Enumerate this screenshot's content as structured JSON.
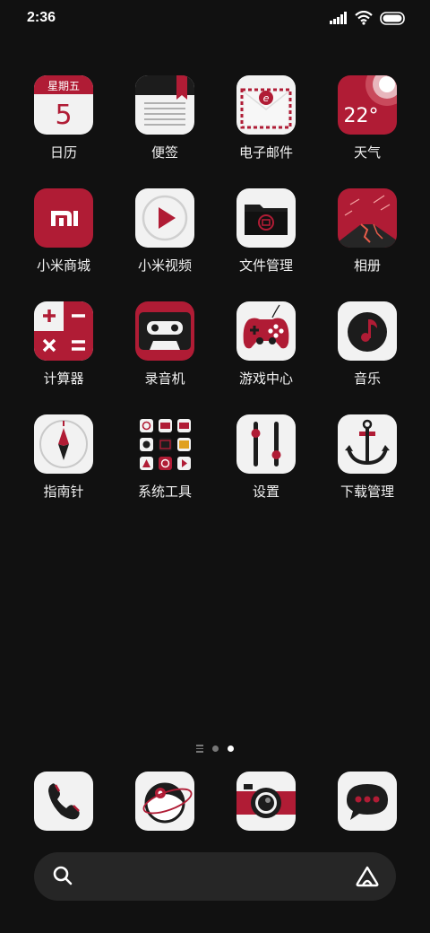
{
  "status": {
    "time": "2:36",
    "icons": [
      "signal-icon",
      "wifi-icon",
      "battery-icon"
    ]
  },
  "colors": {
    "background": "#111111",
    "accent": "#b01c35",
    "tile": "#f2f2f2",
    "dark": "#1c1c1c"
  },
  "calendar": {
    "weekday": "星期五",
    "day": "5"
  },
  "weather": {
    "temp": "22°"
  },
  "apps": [
    {
      "label": "日历",
      "icon": "calendar-icon"
    },
    {
      "label": "便签",
      "icon": "notes-icon"
    },
    {
      "label": "电子邮件",
      "icon": "email-icon"
    },
    {
      "label": "天气",
      "icon": "weather-icon"
    },
    {
      "label": "小米商城",
      "icon": "mi-store-icon"
    },
    {
      "label": "小米视频",
      "icon": "video-play-icon"
    },
    {
      "label": "文件管理",
      "icon": "folder-icon"
    },
    {
      "label": "相册",
      "icon": "volcano-gallery-icon"
    },
    {
      "label": "计算器",
      "icon": "calculator-icon"
    },
    {
      "label": "录音机",
      "icon": "cassette-icon"
    },
    {
      "label": "游戏中心",
      "icon": "gamepad-icon"
    },
    {
      "label": "音乐",
      "icon": "music-note-icon"
    },
    {
      "label": "指南针",
      "icon": "compass-icon"
    },
    {
      "label": "系统工具",
      "icon": "app-folder-icon"
    },
    {
      "label": "设置",
      "icon": "sliders-icon"
    },
    {
      "label": "下载管理",
      "icon": "anchor-icon"
    }
  ],
  "pages": {
    "count": 2,
    "active": 2
  },
  "dock": [
    {
      "icon": "phone-icon"
    },
    {
      "icon": "browser-eye-icon"
    },
    {
      "icon": "camera-icon"
    },
    {
      "icon": "chat-bubble-icon"
    }
  ],
  "search": {
    "placeholder": ""
  }
}
